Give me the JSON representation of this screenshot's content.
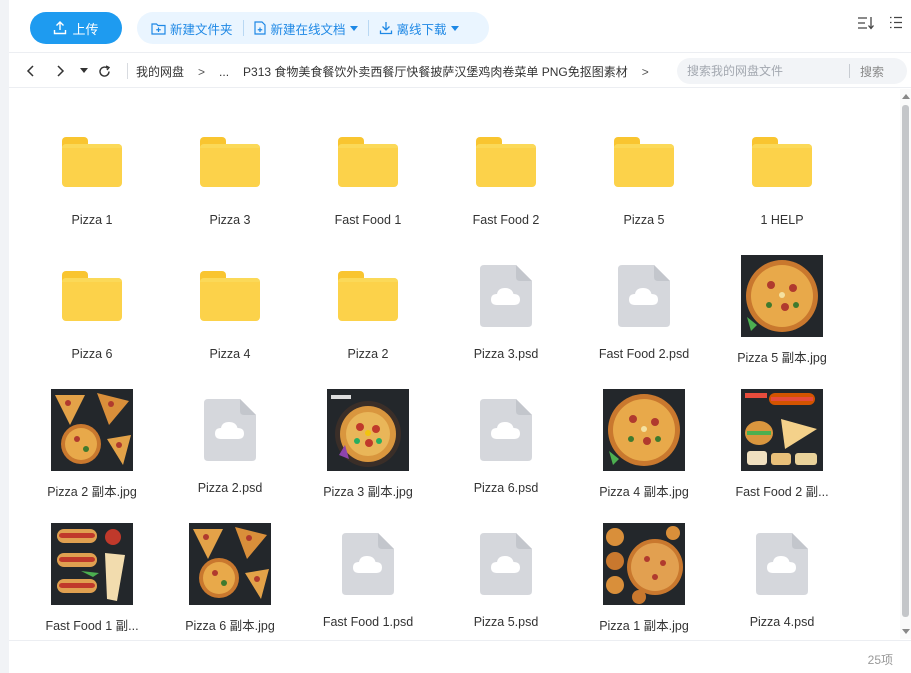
{
  "toolbar": {
    "upload_label": "上传",
    "new_folder_label": "新建文件夹",
    "new_doc_label": "新建在线文档",
    "offline_download_label": "离线下载"
  },
  "nav": {
    "breadcrumbs": [
      "我的网盘",
      ">",
      "...",
      "P313 食物美食餐饮外卖西餐厅快餐披萨汉堡鸡肉卷菜单 PNG免抠图素材",
      ">"
    ],
    "search_placeholder": "搜索我的网盘文件",
    "search_button": "搜索"
  },
  "colors": {
    "accent": "#1e9bf0",
    "folder": "#fcd24a",
    "psd_icon": "#d5d7dc"
  },
  "files": [
    {
      "name": "Pizza 1",
      "type": "folder"
    },
    {
      "name": "Pizza 3",
      "type": "folder"
    },
    {
      "name": "Fast Food 1",
      "type": "folder"
    },
    {
      "name": "Fast Food 2",
      "type": "folder"
    },
    {
      "name": "Pizza 5",
      "type": "folder"
    },
    {
      "name": "1 HELP",
      "type": "folder"
    },
    {
      "name": "Pizza 6",
      "type": "folder"
    },
    {
      "name": "Pizza 4",
      "type": "folder"
    },
    {
      "name": "Pizza 2",
      "type": "folder"
    },
    {
      "name": "Pizza 3.psd",
      "type": "psd"
    },
    {
      "name": "Fast Food 2.psd",
      "type": "psd"
    },
    {
      "name": "Pizza 5 副本.jpg",
      "type": "image",
      "scene": "pizza-whole"
    },
    {
      "name": "Pizza 2 副本.jpg",
      "type": "image",
      "scene": "pizza-slices"
    },
    {
      "name": "Pizza 2.psd",
      "type": "psd"
    },
    {
      "name": "Pizza 3 副本.jpg",
      "type": "image",
      "scene": "pizza-veggie"
    },
    {
      "name": "Pizza 6.psd",
      "type": "psd"
    },
    {
      "name": "Pizza 4 副本.jpg",
      "type": "image",
      "scene": "pizza-whole"
    },
    {
      "name": "Fast Food 2 副...",
      "type": "image",
      "scene": "fastfood-mix"
    },
    {
      "name": "Fast Food 1 副...",
      "type": "image",
      "scene": "hotdog-wrap"
    },
    {
      "name": "Pizza 6 副本.jpg",
      "type": "image",
      "scene": "pizza-slices"
    },
    {
      "name": "Fast Food 1.psd",
      "type": "psd"
    },
    {
      "name": "Pizza 5.psd",
      "type": "psd"
    },
    {
      "name": "Pizza 1 副本.jpg",
      "type": "image",
      "scene": "pizza-multi"
    },
    {
      "name": "Pizza 4.psd",
      "type": "psd"
    }
  ],
  "footer": {
    "count_label": "25项"
  }
}
